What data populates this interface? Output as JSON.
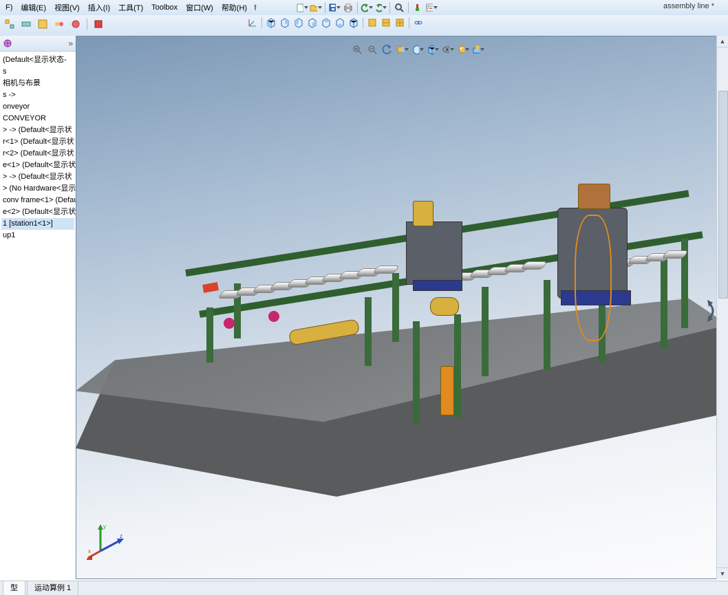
{
  "menu": {
    "file": "F)",
    "edit": "编辑(E)",
    "view": "视图(V)",
    "insert": "插入(I)",
    "tools": "工具(T)",
    "toolbox": "Toolbox",
    "window": "窗口(W)",
    "help": "帮助(H)"
  },
  "document_title": "assembly line *",
  "icons": {
    "new": "new-icon",
    "open": "open-icon",
    "save": "save-icon",
    "print": "print-icon",
    "undo": "undo-icon",
    "redo": "redo-icon",
    "select": "select-icon",
    "rebuild": "rebuild-icon",
    "options": "options-icon",
    "zoom": "zoom-icon"
  },
  "tree": {
    "items": [
      " (Default<显示状态-",
      "s",
      "相机与布景",
      "s ->",
      "onveyor",
      "CONVEYOR",
      "",
      "",
      "> -> (Default<显示状",
      "r<1> (Default<显示状",
      "r<2> (Default<显示状",
      "e<1> (Default<显示状",
      "> -> (Default<显示状",
      "> (No Hardware<显示",
      "conv frame<1> (Defau",
      "",
      "e<2> (Default<显示状",
      "1 [station1<1>]",
      "up1"
    ]
  },
  "heads_up": {
    "zoom_fit": "zoom-fit",
    "zoom_area": "zoom-area",
    "prev_view": "prev-view",
    "section": "section",
    "view_orient": "view-orientation",
    "display_style": "display-style",
    "hide_show": "hide-show",
    "appearance": "appearance",
    "scene": "apply-scene",
    "view_settings": "view-settings"
  },
  "view_toolbar": {
    "axis": "coordinate-axis",
    "front": "front-view",
    "back": "back-view",
    "left": "left-view",
    "right": "right-view",
    "top": "top-view",
    "bottom": "bottom-view",
    "iso": "isometric",
    "trim": "trimetric",
    "dim": "dimetric",
    "single": "single-view",
    "link": "link-views"
  },
  "bottom_tabs": {
    "tab1": "型",
    "tab2": "运动算例 1"
  },
  "triad": {
    "x": "x",
    "y": "y",
    "z": "z"
  }
}
